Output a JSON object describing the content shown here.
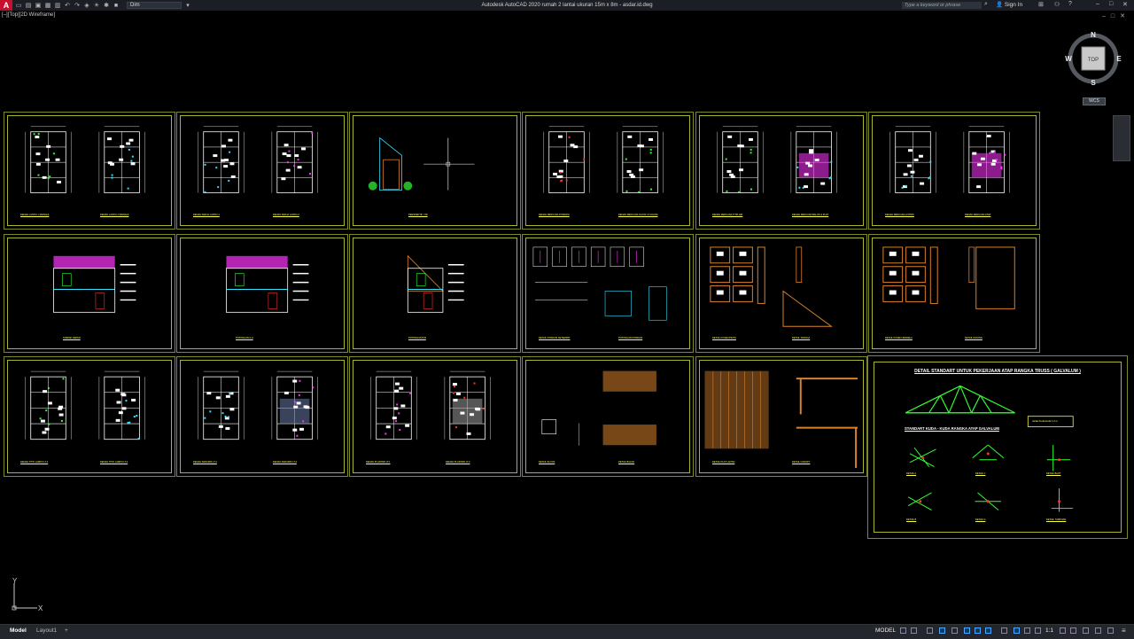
{
  "app": {
    "title": "Autodesk AutoCAD 2020    rumah 2 lantai ukuran 15m x 8m - asdar.id.dwg",
    "logo": "A",
    "workspace": "Dim",
    "search_placeholder": "Type a keyword or phrase",
    "signin_label": "Sign In",
    "viewport_label": "[–][Top][2D Wireframe]"
  },
  "viewcube": {
    "north": "N",
    "south": "S",
    "east": "E",
    "west": "W",
    "face": "TOP",
    "wcs": "WCS"
  },
  "ucs": {
    "x": "X",
    "y": "Y"
  },
  "sheets": [
    {
      "id": "s1",
      "labels": [
        "DENAH LANTAI 1 (DENAH)",
        "DENAH LANTAI 2 (DENAH)"
      ]
    },
    {
      "id": "s2",
      "labels": [
        "DENAH KERJA LANTAI 1",
        "DENAH KERJA LANTAI 2"
      ]
    },
    {
      "id": "s3",
      "labels": [
        "PERSPEKTIF / 3D"
      ]
    },
    {
      "id": "s4",
      "labels": [
        "DENAH RENCANA PONDASI",
        "DENAH RENCANA SLOOF & KOLOM"
      ]
    },
    {
      "id": "s5",
      "labels": [
        "DENAH RENCANA TITIK AIR",
        "DENAH RENCANA BALOK & PLAT"
      ]
    },
    {
      "id": "s6",
      "labels": [
        "DENAH RENCANA LISTRIK",
        "DENAH RENCANA ATAP"
      ]
    },
    {
      "id": "s7",
      "labels": [
        "TAMPAK DEPAN"
      ]
    },
    {
      "id": "s8",
      "labels": [
        "POTONGAN A-A"
      ]
    },
    {
      "id": "s9",
      "labels": [
        "POTONGAN B-B"
      ]
    },
    {
      "id": "s10",
      "labels": [
        "DETAIL PONDASI SETEMPAT",
        "POTONGAN PONDASI"
      ]
    },
    {
      "id": "s11",
      "labels": [
        "DETAIL KUSEN PINTU",
        "DETAIL TANGGA"
      ]
    },
    {
      "id": "s12",
      "labels": [
        "DETAIL KUSEN JENDELA",
        "DETAIL RAILING"
      ]
    },
    {
      "id": "s13",
      "labels": [
        "DENAH TITIK LAMPU LT.1",
        "DENAH TITIK LAMPU LT.2"
      ]
    },
    {
      "id": "s14",
      "labels": [
        "DENAH KERAMIK LT.1",
        "DENAH KERAMIK LT.2"
      ]
    },
    {
      "id": "s15",
      "labels": [
        "DENAH PLAFOND LT.1",
        "DENAH PLAFOND LT.2"
      ]
    },
    {
      "id": "s16",
      "labels": [
        "DETAIL SLOOF",
        "DETAIL BALOK"
      ]
    },
    {
      "id": "s17",
      "labels": [
        "DETAIL PLAT LANTAI",
        "DETAIL CANOPY"
      ]
    }
  ],
  "truss_sheet": {
    "title": "DETAIL STANDART UNTUK PEKERJAAN ATAP RANGKA TRUSS ( GALVALUM )",
    "subtitle": "STANDART KUDA - KUDA RANGKA ATAP GALVALUM",
    "details": [
      "DETAIL A",
      "DETAIL C",
      "DETAIL B",
      "DETAIL D",
      "DETAIL BAUT",
      "DETAIL TUMPUAN"
    ],
    "note": "Jarak Kuda-kuda 1.2 m"
  },
  "status": {
    "tab_model": "Model",
    "tab_layout": "Layout1",
    "tab_add": "+",
    "model": "MODEL",
    "scale": "1:1"
  },
  "colors": {
    "frame": "#a9b52e",
    "label": "#ffff4a",
    "wall": "#ffffff",
    "accent_cyan": "#33e3ff",
    "accent_magenta": "#ff33ff",
    "accent_green": "#33ff33",
    "accent_red": "#ff3333",
    "wood": "#d9822b"
  }
}
